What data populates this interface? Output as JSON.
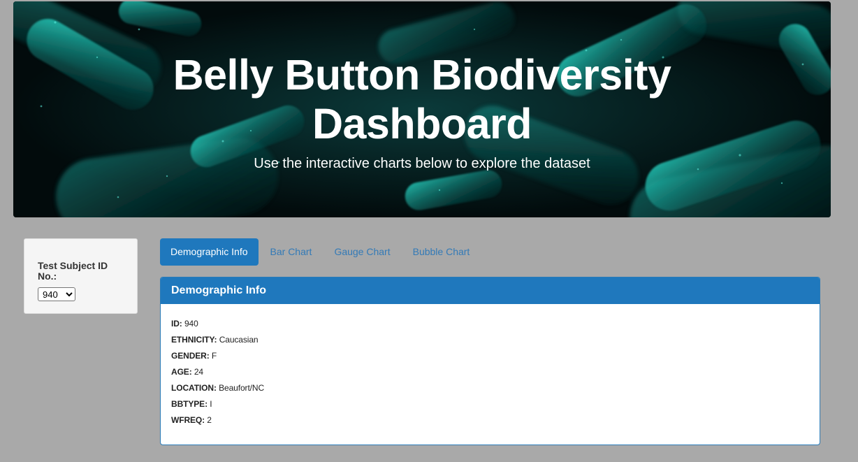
{
  "hero": {
    "title_line1": "Belly Button Biodiversity",
    "title_line2": "Dashboard",
    "subtitle": "Use the interactive charts below to explore the dataset",
    "background": "teal-bacteria-illustration"
  },
  "selector": {
    "label": "Test Subject ID No.:",
    "selected_value": "940",
    "options": [
      "940"
    ]
  },
  "tabs": [
    {
      "label": "Demographic Info",
      "active": true
    },
    {
      "label": "Bar Chart",
      "active": false
    },
    {
      "label": "Gauge Chart",
      "active": false
    },
    {
      "label": "Bubble Chart",
      "active": false
    }
  ],
  "panel": {
    "heading": "Demographic Info",
    "rows": [
      {
        "key": "ID:",
        "value": "940"
      },
      {
        "key": "ETHNICITY:",
        "value": "Caucasian"
      },
      {
        "key": "GENDER:",
        "value": "F"
      },
      {
        "key": "AGE:",
        "value": "24"
      },
      {
        "key": "LOCATION:",
        "value": "Beaufort/NC"
      },
      {
        "key": "BBTYPE:",
        "value": "I"
      },
      {
        "key": "WFREQ:",
        "value": "2"
      }
    ]
  },
  "colors": {
    "page_bg": "#a9a9a9",
    "accent": "#1f78bd",
    "link": "#337ab7",
    "hero_glow": "#1fc9b8"
  }
}
